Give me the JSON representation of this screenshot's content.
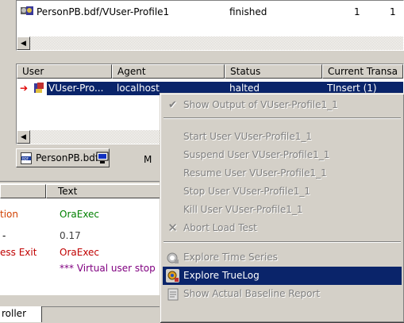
{
  "top_table": {
    "row": {
      "name": "PersonPB.bdf/VUser-Profile1",
      "status": "finished",
      "col3": "1",
      "col4": "1"
    }
  },
  "user_table": {
    "headers": {
      "user": "User",
      "agent": "Agent",
      "status": "Status",
      "current": "Current Transa"
    },
    "row": {
      "user": "VUser-Pro...",
      "agent": "localhost",
      "status": "halted",
      "current": "TInsert (1)"
    }
  },
  "tabs": {
    "file_tab": "PersonPB.bdf",
    "monitor_tab": "M"
  },
  "log_table": {
    "header_text": "Text",
    "rows": [
      {
        "left": "tion",
        "text": "OraExec",
        "left_color": "#d04000",
        "text_color": "#008000"
      },
      {
        "left": "-",
        "text": "0.17",
        "left_color": "#000000",
        "text_color": "#404040"
      },
      {
        "left": "ess Exit",
        "text": "OraExec",
        "left_color": "#c00000",
        "text_color": "#c00000"
      },
      {
        "left": "",
        "text": "*** Virtual user stop",
        "left_color": "#000000",
        "text_color": "#800080"
      }
    ]
  },
  "bottom_tab": "roller",
  "context_menu": {
    "items": [
      {
        "label": "Show Output of VUser-Profile1_1",
        "icon": "check-icon"
      },
      {
        "label": "Start User VUser-Profile1_1"
      },
      {
        "label": "Suspend User VUser-Profile1_1"
      },
      {
        "label": "Resume User VUser-Profile1_1"
      },
      {
        "label": "Stop User VUser-Profile1_1"
      },
      {
        "label": "Kill User VUser-Profile1_1"
      },
      {
        "label": "Abort Load Test",
        "icon": "x-icon"
      },
      {
        "label": "Explore Time Series",
        "icon": "time-series-icon"
      },
      {
        "label": "Explore TrueLog",
        "icon": "truelog-icon",
        "highlighted": true
      },
      {
        "label": "Show Actual Baseline Report",
        "icon": "report-icon"
      }
    ]
  },
  "colors": {
    "selection": "#0a246a",
    "face": "#d4d0c8"
  }
}
